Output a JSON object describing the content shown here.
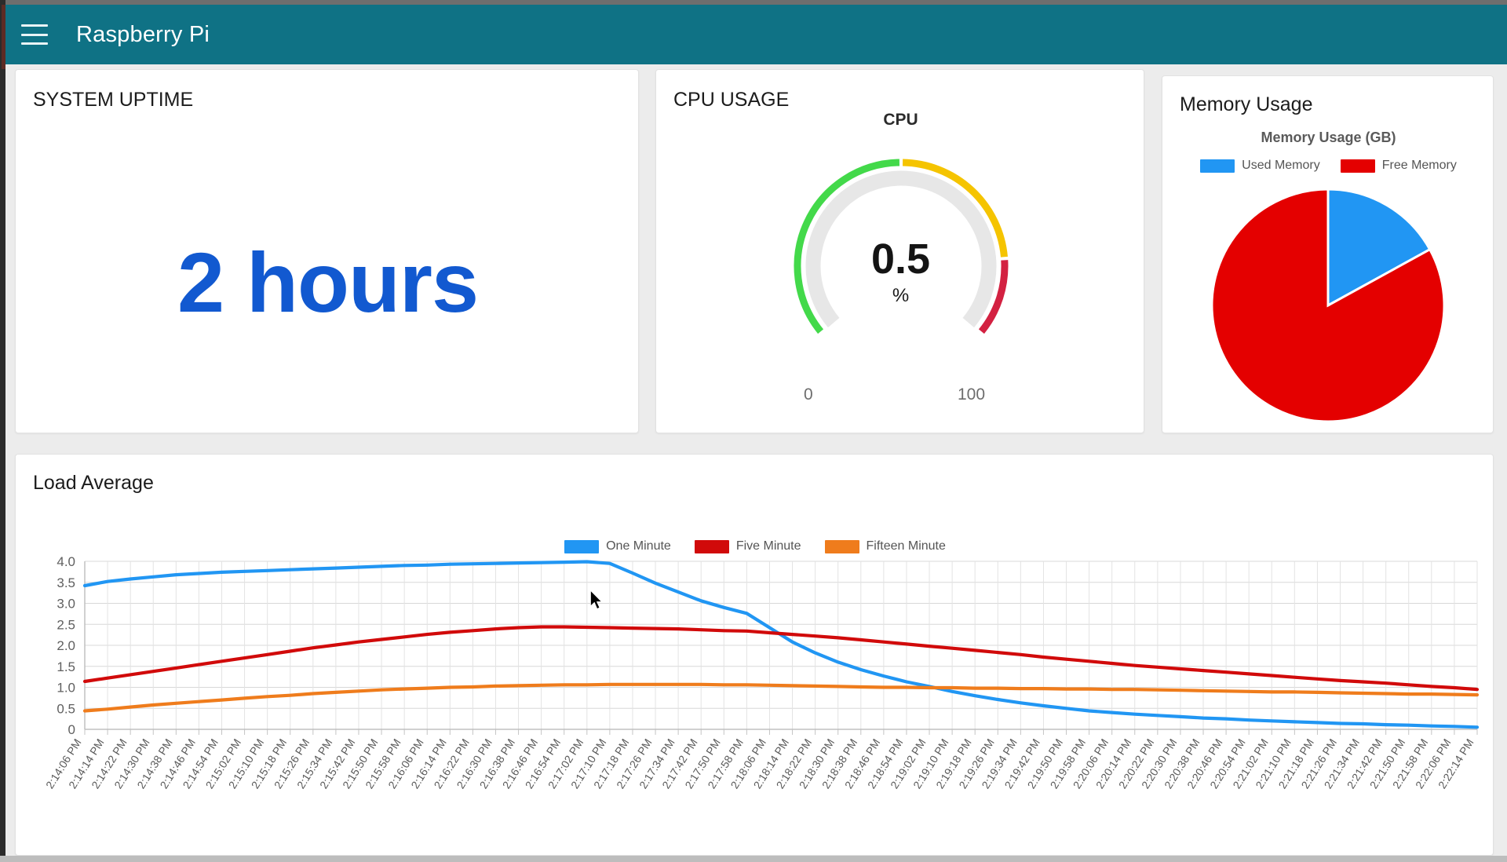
{
  "window": {
    "title_bar_color": "#6e6e6e"
  },
  "header": {
    "title": "Raspberry Pi",
    "menu_icon": "hamburger-icon",
    "background": "#0f7285"
  },
  "cards": {
    "uptime": {
      "title": "SYSTEM UPTIME",
      "value": "2 hours",
      "value_color": "#1259d0"
    },
    "cpu": {
      "title": "CPU USAGE",
      "gauge_label": "CPU",
      "value": "0.5",
      "unit": "%",
      "min_label": "0",
      "max_label": "100",
      "colors": {
        "low": "#43d94a",
        "mid": "#f5c400",
        "high": "#d32141",
        "track": "#e5e5e5"
      }
    },
    "memory": {
      "title": "Memory Usage",
      "subtitle": "Memory Usage (GB)",
      "legend": [
        {
          "label": "Used Memory",
          "color": "#2196f3"
        },
        {
          "label": "Free Memory",
          "color": "#e40000"
        }
      ]
    },
    "load": {
      "title": "Load Average"
    }
  },
  "chart_data": [
    {
      "type": "pie",
      "title": "Memory Usage (GB)",
      "labels": [
        "Used Memory",
        "Free Memory"
      ],
      "values": [
        17,
        83
      ],
      "colors": [
        "#2196f3",
        "#e40000"
      ],
      "legend_position": "top"
    },
    {
      "type": "line",
      "title": "Load Average",
      "xlabel": "",
      "ylabel": "",
      "ylim": [
        0,
        4.0
      ],
      "yticks": [
        "0",
        "0.5",
        "1.0",
        "1.5",
        "2.0",
        "2.5",
        "3.0",
        "3.5",
        "4.0"
      ],
      "grid": true,
      "legend_position": "top",
      "x": [
        "2:14:06 PM",
        "2:14:14 PM",
        "2:14:22 PM",
        "2:14:30 PM",
        "2:14:38 PM",
        "2:14:46 PM",
        "2:14:54 PM",
        "2:15:02 PM",
        "2:15:10 PM",
        "2:15:18 PM",
        "2:15:26 PM",
        "2:15:34 PM",
        "2:15:42 PM",
        "2:15:50 PM",
        "2:15:58 PM",
        "2:16:06 PM",
        "2:16:14 PM",
        "2:16:22 PM",
        "2:16:30 PM",
        "2:16:38 PM",
        "2:16:46 PM",
        "2:16:54 PM",
        "2:17:02 PM",
        "2:17:10 PM",
        "2:17:18 PM",
        "2:17:26 PM",
        "2:17:34 PM",
        "2:17:42 PM",
        "2:17:50 PM",
        "2:17:58 PM",
        "2:18:06 PM",
        "2:18:14 PM",
        "2:18:22 PM",
        "2:18:30 PM",
        "2:18:38 PM",
        "2:18:46 PM",
        "2:18:54 PM",
        "2:19:02 PM",
        "2:19:10 PM",
        "2:19:18 PM",
        "2:19:26 PM",
        "2:19:34 PM",
        "2:19:42 PM",
        "2:19:50 PM",
        "2:19:58 PM",
        "2:20:06 PM",
        "2:20:14 PM",
        "2:20:22 PM",
        "2:20:30 PM",
        "2:20:38 PM",
        "2:20:46 PM",
        "2:20:54 PM",
        "2:21:02 PM",
        "2:21:10 PM",
        "2:21:18 PM",
        "2:21:26 PM",
        "2:21:34 PM",
        "2:21:42 PM",
        "2:21:50 PM",
        "2:21:58 PM",
        "2:22:06 PM",
        "2:22:14 PM"
      ],
      "series": [
        {
          "name": "One Minute",
          "color": "#2196f3",
          "values": [
            3.42,
            3.52,
            3.58,
            3.63,
            3.68,
            3.71,
            3.74,
            3.76,
            3.78,
            3.8,
            3.82,
            3.84,
            3.86,
            3.88,
            3.9,
            3.91,
            3.93,
            3.94,
            3.95,
            3.96,
            3.97,
            3.98,
            3.99,
            3.95,
            3.72,
            3.48,
            3.27,
            3.06,
            2.9,
            2.76,
            2.42,
            2.08,
            1.82,
            1.6,
            1.42,
            1.27,
            1.13,
            1.02,
            0.9,
            0.8,
            0.71,
            0.63,
            0.56,
            0.5,
            0.44,
            0.4,
            0.36,
            0.33,
            0.3,
            0.27,
            0.25,
            0.22,
            0.2,
            0.18,
            0.16,
            0.14,
            0.13,
            0.11,
            0.1,
            0.08,
            0.07,
            0.05
          ]
        },
        {
          "name": "Five Minute",
          "color": "#d10a0a",
          "values": [
            1.14,
            1.22,
            1.3,
            1.38,
            1.46,
            1.54,
            1.62,
            1.7,
            1.78,
            1.86,
            1.94,
            2.01,
            2.08,
            2.14,
            2.2,
            2.26,
            2.31,
            2.35,
            2.39,
            2.42,
            2.44,
            2.44,
            2.43,
            2.42,
            2.41,
            2.4,
            2.39,
            2.37,
            2.35,
            2.34,
            2.3,
            2.26,
            2.22,
            2.18,
            2.13,
            2.08,
            2.03,
            1.98,
            1.93,
            1.88,
            1.83,
            1.78,
            1.72,
            1.67,
            1.62,
            1.57,
            1.52,
            1.48,
            1.44,
            1.4,
            1.36,
            1.32,
            1.28,
            1.24,
            1.2,
            1.16,
            1.13,
            1.1,
            1.06,
            1.02,
            0.99,
            0.95
          ]
        },
        {
          "name": "Fifteen Minute",
          "color": "#ef7c1c",
          "values": [
            0.44,
            0.48,
            0.53,
            0.58,
            0.62,
            0.66,
            0.7,
            0.74,
            0.78,
            0.81,
            0.85,
            0.88,
            0.91,
            0.94,
            0.96,
            0.98,
            1.0,
            1.01,
            1.03,
            1.04,
            1.05,
            1.06,
            1.06,
            1.07,
            1.07,
            1.07,
            1.07,
            1.07,
            1.06,
            1.06,
            1.05,
            1.04,
            1.03,
            1.02,
            1.01,
            1.0,
            1.0,
            0.99,
            0.99,
            0.98,
            0.98,
            0.97,
            0.97,
            0.96,
            0.96,
            0.95,
            0.95,
            0.94,
            0.93,
            0.92,
            0.91,
            0.9,
            0.89,
            0.89,
            0.88,
            0.87,
            0.86,
            0.85,
            0.84,
            0.84,
            0.83,
            0.82
          ]
        }
      ]
    }
  ],
  "gauge_data": {
    "type": "gauge",
    "title": "CPU",
    "value": 0.5,
    "unit": "%",
    "min": 0,
    "max": 100,
    "bands": [
      {
        "from": 0,
        "to": 50,
        "color": "#43d94a"
      },
      {
        "from": 50,
        "to": 83,
        "color": "#f5c400"
      },
      {
        "from": 83,
        "to": 100,
        "color": "#d32141"
      }
    ]
  }
}
